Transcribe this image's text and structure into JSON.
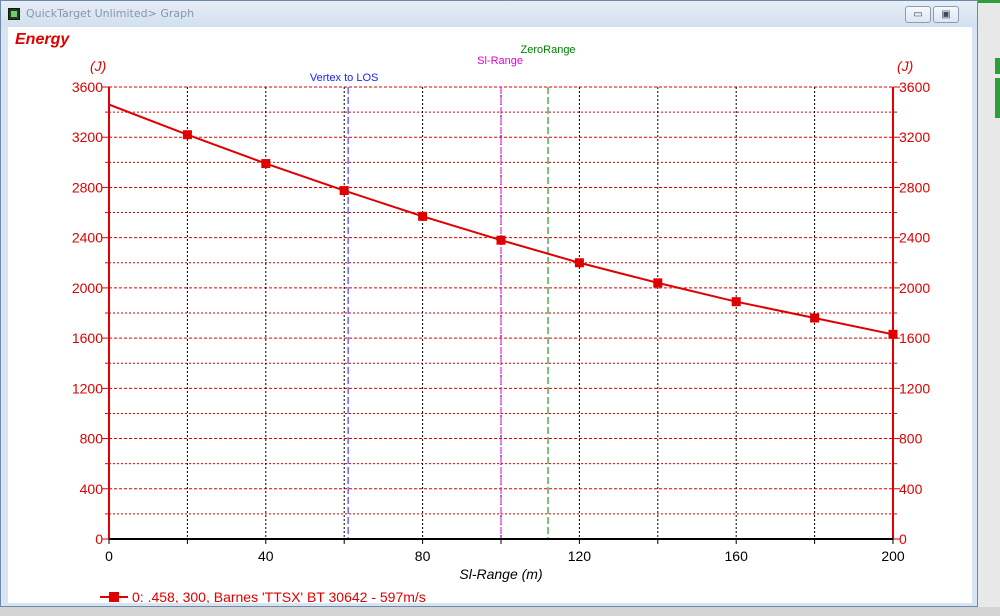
{
  "window": {
    "title": "QuickTarget Unlimited> Graph"
  },
  "window_controls": {
    "minimize": "▭",
    "maximize": "▣"
  },
  "chart_data": {
    "type": "line",
    "title": "Energy",
    "xlabel": "Sl-Range (m)",
    "ylabel": "(J)",
    "ylabel_right": "(J)",
    "xlim": [
      0,
      200
    ],
    "ylim": [
      0,
      3600
    ],
    "x_ticks": [
      0,
      40,
      80,
      120,
      160,
      200
    ],
    "y_ticks": [
      0,
      400,
      800,
      1200,
      1600,
      2000,
      2400,
      2800,
      3200,
      3600
    ],
    "grid": true,
    "legend_position": "bottom-left",
    "series": [
      {
        "name": "0: .458, 300, Barnes 'TTSX' BT 30642 - 597m/s",
        "x": [
          0,
          20,
          40,
          60,
          80,
          100,
          120,
          140,
          160,
          180,
          200
        ],
        "y": [
          3460,
          3220,
          2990,
          2775,
          2570,
          2380,
          2200,
          2040,
          1890,
          1760,
          1630
        ],
        "markers_x": [
          20,
          40,
          60,
          80,
          100,
          120,
          140,
          160,
          180,
          200
        ],
        "color": "#e00000"
      }
    ],
    "vlines": [
      {
        "label": "Vertex to LOS",
        "x": 61,
        "color": "#2020ff"
      },
      {
        "label": "Sl-Range",
        "x": 100,
        "color": "#e000e0"
      },
      {
        "label": "ZeroRange",
        "x": 112,
        "color": "#008000"
      }
    ]
  }
}
